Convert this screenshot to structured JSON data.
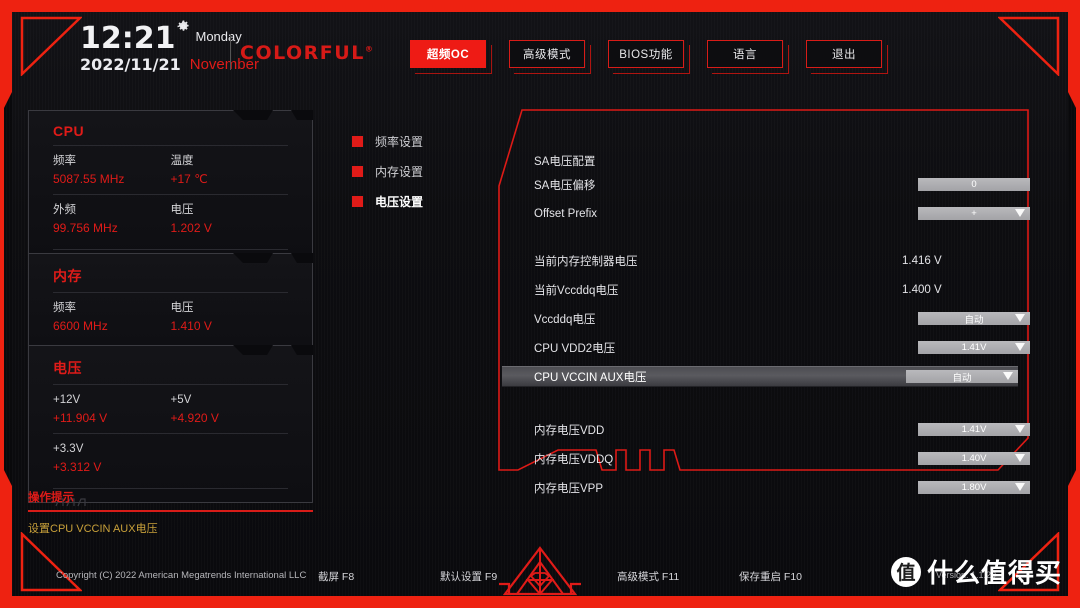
{
  "header": {
    "time": "12:21",
    "date": "2022/11/21",
    "weekday": "Monday",
    "month": "November",
    "brand": "COLORFUL",
    "brand_mark": "®",
    "gear_icon": "gear-icon"
  },
  "nav": {
    "items": [
      {
        "label": "超频OC",
        "active": true
      },
      {
        "label": "高级模式",
        "active": false
      },
      {
        "label": "BIOS功能",
        "active": false
      },
      {
        "label": "语言",
        "active": false
      },
      {
        "label": "退出",
        "active": false
      }
    ]
  },
  "cards": [
    {
      "title": "CPU",
      "rows": [
        [
          {
            "label": "频率",
            "value": "5087.55 MHz"
          },
          {
            "label": "温度",
            "value": "+17 ℃"
          }
        ],
        [
          {
            "label": "外频",
            "value": "99.756 MHz"
          },
          {
            "label": "电压",
            "value": "1.202 V"
          }
        ]
      ]
    },
    {
      "title": "内存",
      "rows": [
        [
          {
            "label": "频率",
            "value": "6600 MHz"
          },
          {
            "label": "电压",
            "value": "1.410 V"
          }
        ]
      ]
    },
    {
      "title": "电压",
      "rows": [
        [
          {
            "label": "+12V",
            "value": "+11.904 V"
          },
          {
            "label": "+5V",
            "value": "+4.920 V"
          }
        ],
        [
          {
            "label": "+3.3V",
            "value": "+3.312 V"
          },
          {
            "label": "",
            "value": ""
          }
        ]
      ]
    }
  ],
  "tips": {
    "title": "操作提示",
    "text": "设置CPU VCCIN AUX电压"
  },
  "midmenu": {
    "items": [
      {
        "label": "频率设置",
        "active": false
      },
      {
        "label": "内存设置",
        "active": false
      },
      {
        "label": "电压设置",
        "active": true
      }
    ]
  },
  "main": {
    "section_title": "SA电压配置",
    "group1": [
      {
        "label": "SA电压偏移",
        "value": "0",
        "type": "input"
      },
      {
        "label": "Offset Prefix",
        "value": "+",
        "type": "dropdown"
      }
    ],
    "group2": [
      {
        "label": "当前内存控制器电压",
        "value": "1.416 V",
        "type": "static"
      },
      {
        "label": "当前Vccddq电压",
        "value": "1.400 V",
        "type": "static"
      },
      {
        "label": "Vccddq电压",
        "value": "自动",
        "type": "dropdown"
      },
      {
        "label": "CPU VDD2电压",
        "value": "1.41V",
        "type": "dropdown"
      },
      {
        "label": "CPU VCCIN AUX电压",
        "value": "自动",
        "type": "dropdown",
        "selected": true
      }
    ],
    "group3": [
      {
        "label": "内存电压VDD",
        "value": "1.41V",
        "type": "dropdown"
      },
      {
        "label": "内存电压VDDQ",
        "value": "1.40V",
        "type": "dropdown"
      },
      {
        "label": "内存电压VPP",
        "value": "1.80V",
        "type": "dropdown"
      }
    ]
  },
  "footer": {
    "copyright": "Copyright (C) 2022 American Megatrends International LLC",
    "keys": [
      {
        "label": "截屏 F8"
      },
      {
        "label": "默认设置 F9"
      },
      {
        "label": "高级模式 F11"
      },
      {
        "label": "保存重启 F10"
      }
    ],
    "version": "Version: 1.1.20",
    "logo": "colorful-emblem-icon"
  },
  "watermark": {
    "mark": "值",
    "text": "什么值得买"
  },
  "colors": {
    "accent_red": "#e01b18",
    "bright_red": "#ee1b15",
    "panel_bg": "#0d0d10",
    "field_gray": "#a8a8ac",
    "tip_gold": "#c8a03a"
  }
}
